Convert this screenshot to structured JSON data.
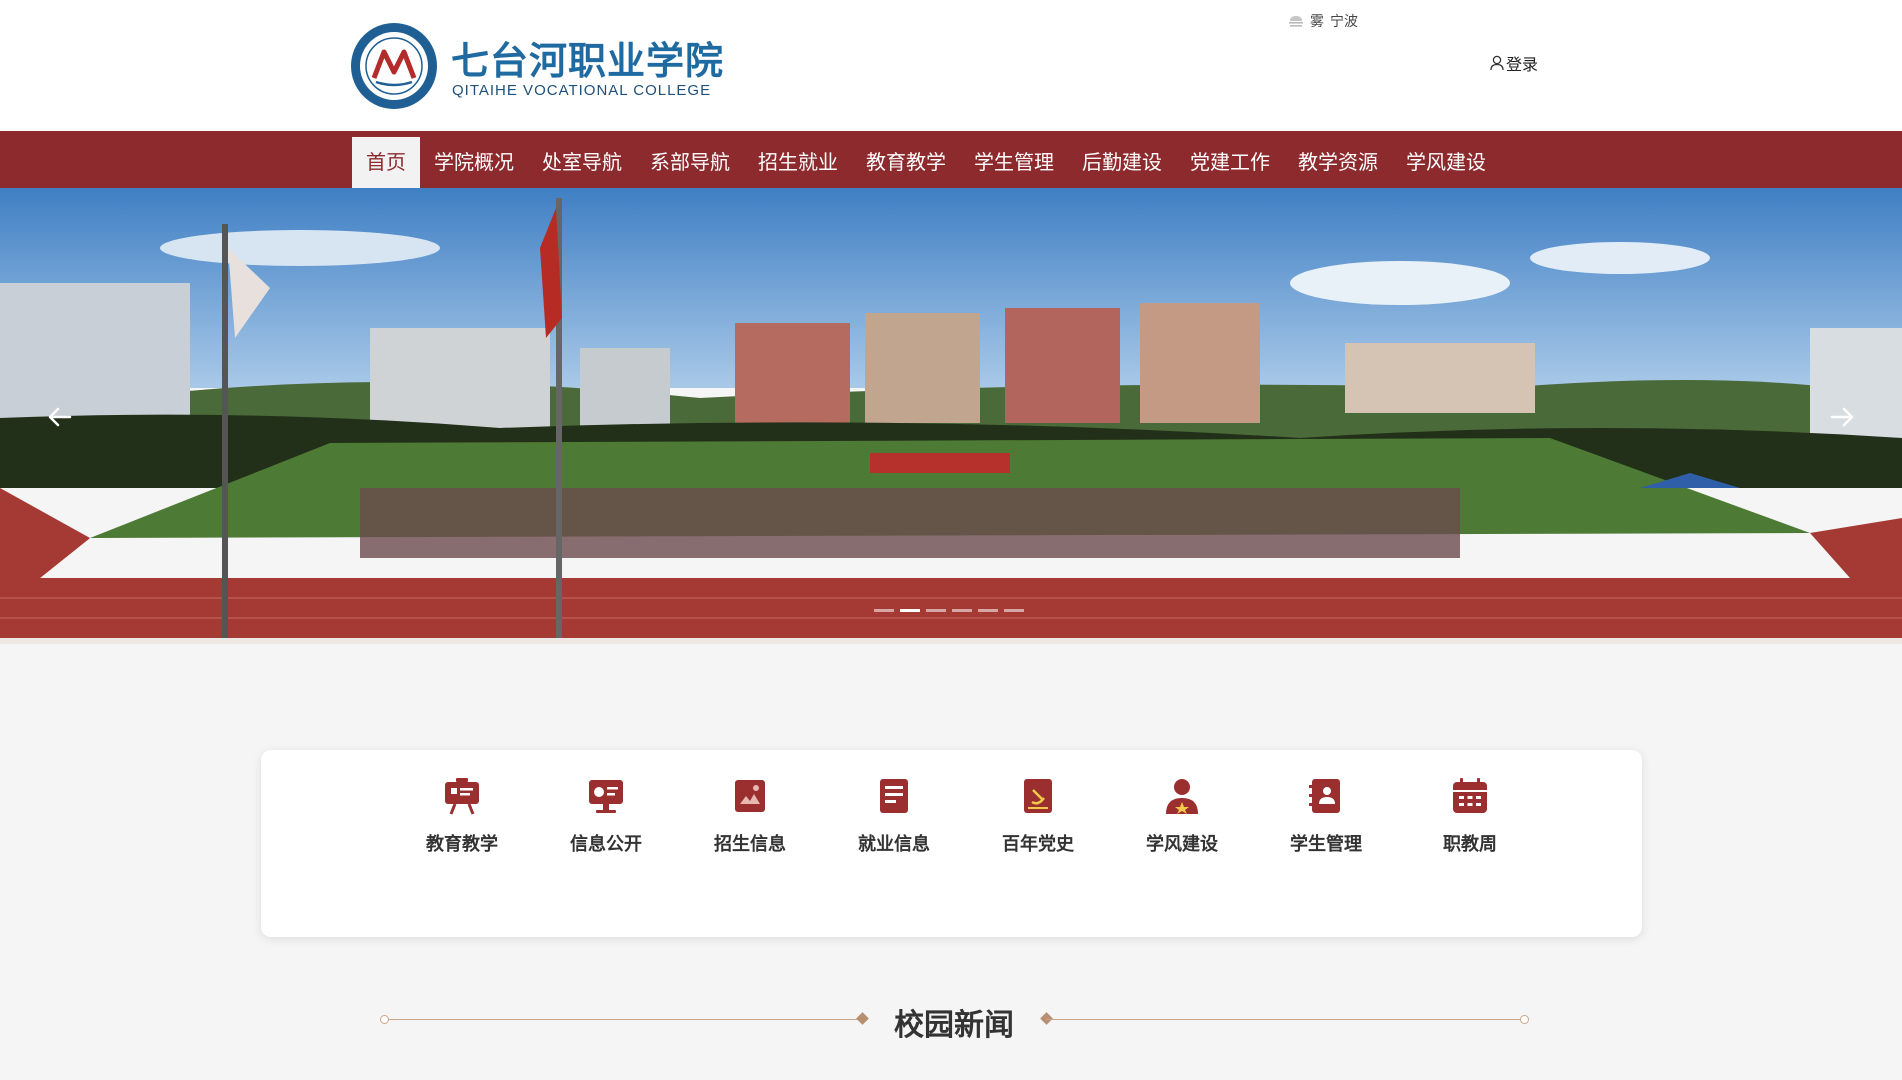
{
  "header": {
    "college_name_cn": "七台河职业学院",
    "college_name_en": "QITAIHE VOCATIONAL COLLEGE",
    "logo_icon": "college-seal-icon",
    "weather": {
      "condition": "雾",
      "city": "宁波",
      "icon": "fog-icon"
    },
    "login_label": "登录",
    "login_icon": "user-icon"
  },
  "nav": {
    "items": [
      {
        "label": "首页",
        "active": true
      },
      {
        "label": "学院概况"
      },
      {
        "label": "处室导航"
      },
      {
        "label": "系部导航"
      },
      {
        "label": "招生就业"
      },
      {
        "label": "教育教学"
      },
      {
        "label": "学生管理"
      },
      {
        "label": "后勤建设"
      },
      {
        "label": "党建工作"
      },
      {
        "label": "教学资源"
      },
      {
        "label": "学风建设"
      }
    ]
  },
  "banner": {
    "slide_count": 6,
    "active_slide": 2,
    "prev_icon": "arrow-left-icon",
    "next_icon": "arrow-right-icon"
  },
  "quick_links": [
    {
      "label": "教育教学",
      "icon": "presentation-board-icon"
    },
    {
      "label": "信息公开",
      "icon": "info-screen-icon"
    },
    {
      "label": "招生信息",
      "icon": "enrollment-doc-icon"
    },
    {
      "label": "就业信息",
      "icon": "job-doc-icon"
    },
    {
      "label": "百年党史",
      "icon": "party-book-icon"
    },
    {
      "label": "学风建设",
      "icon": "student-icon"
    },
    {
      "label": "学生管理",
      "icon": "student-file-icon"
    },
    {
      "label": "职教周",
      "icon": "calendar-icon"
    }
  ],
  "sections": {
    "campus_news": "校园新闻"
  },
  "colors": {
    "brand_red": "#8c2a2d",
    "brand_blue": "#1f6aa0",
    "accent_gold": "#c9a58a",
    "icon_red": "#9b2f2f"
  }
}
